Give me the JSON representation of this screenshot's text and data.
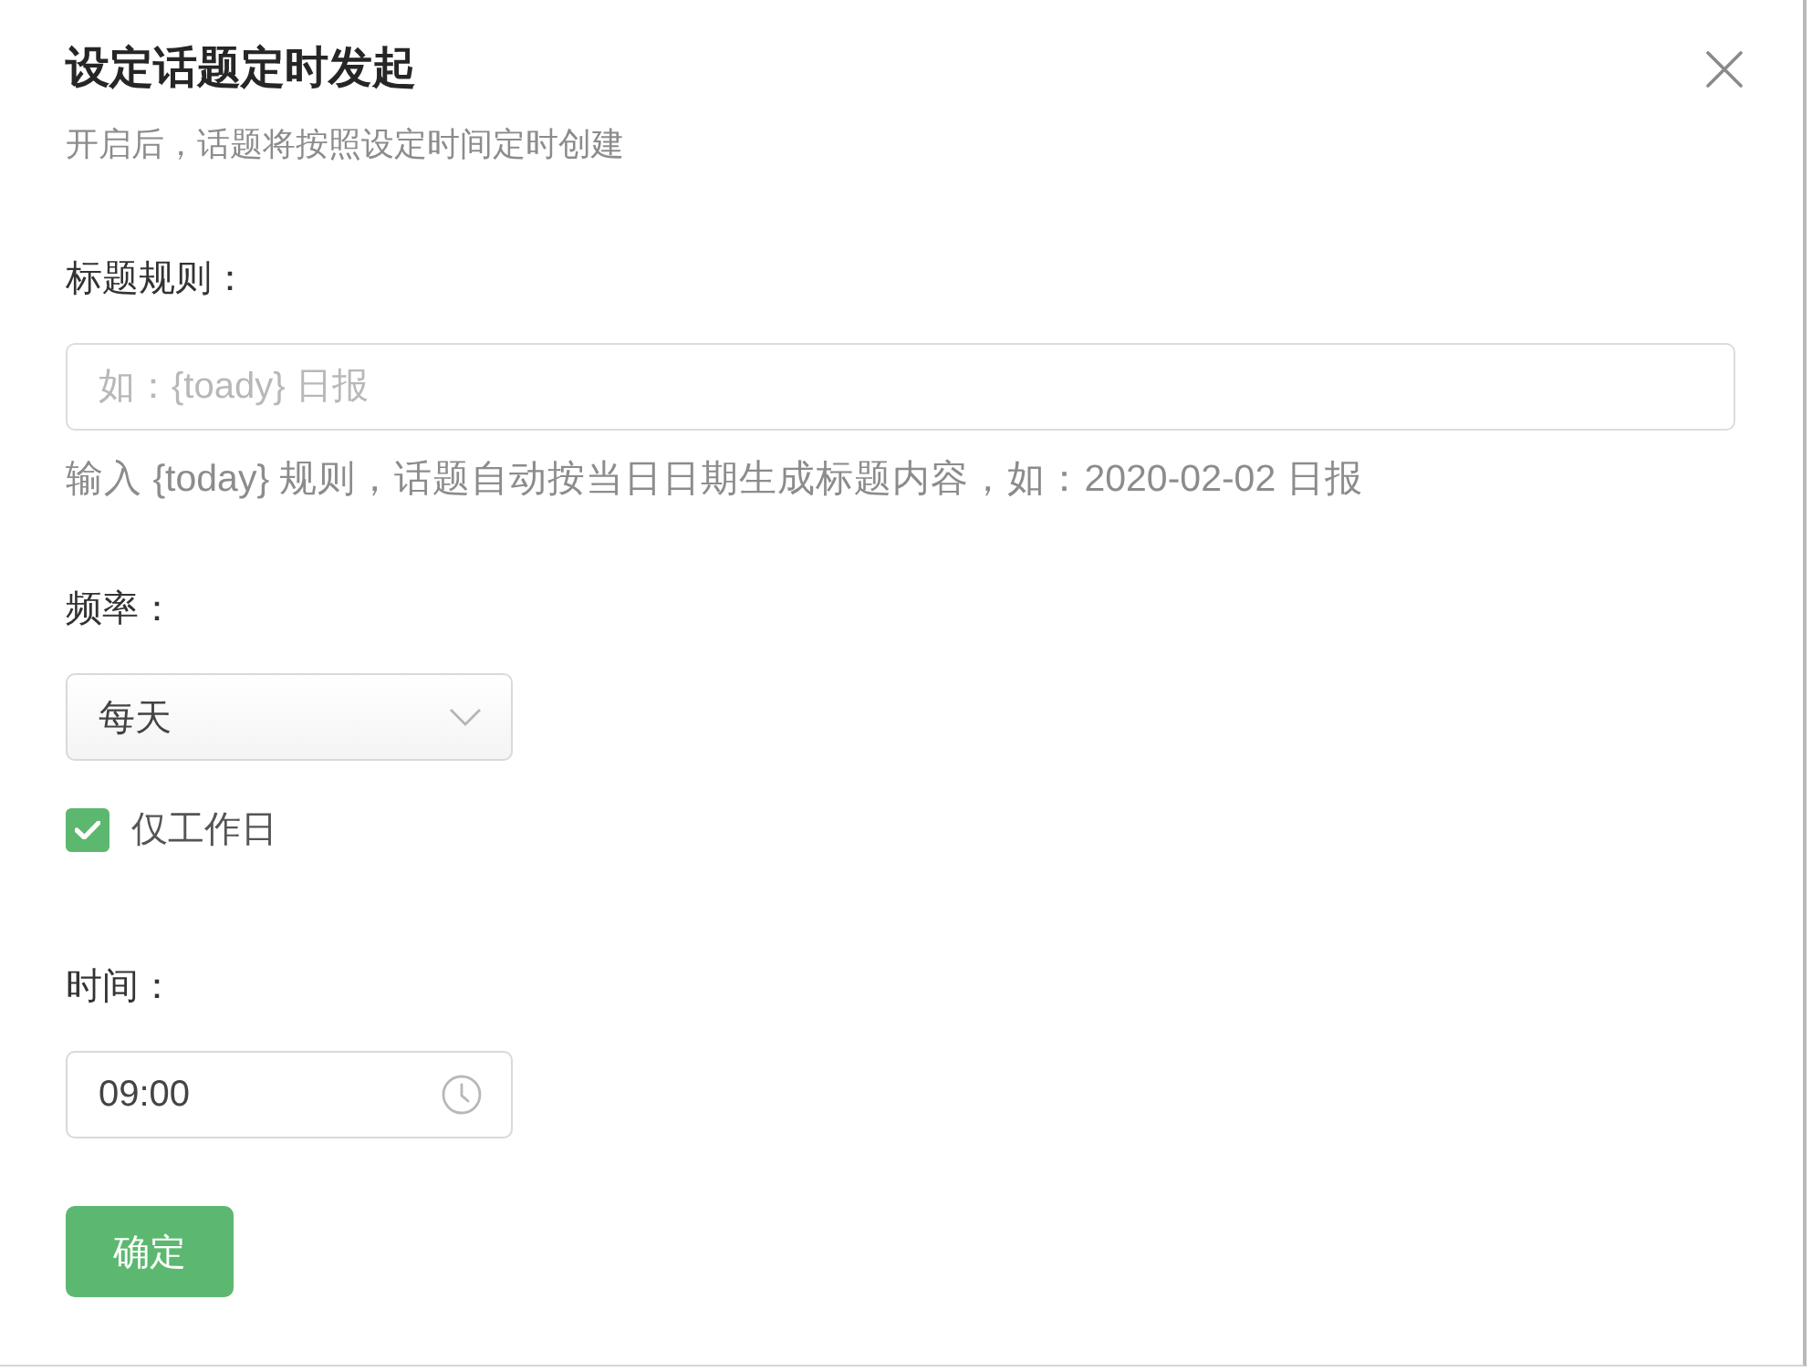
{
  "dialog": {
    "title": "设定话题定时发起",
    "subtitle": "开启后，话题将按照设定时间定时创建"
  },
  "fields": [
    {
      "kind": "text",
      "label": "标题规则：",
      "placeholder": "如：{toady} 日报",
      "hint": "输入 {today} 规则，话题自动按当日日期生成标题内容，如：2020-02-02 日报"
    },
    {
      "kind": "select",
      "label": "频率：",
      "value": "每天"
    },
    {
      "kind": "checkbox",
      "label": "仅工作日",
      "checked": true
    },
    {
      "kind": "time",
      "label": "时间：",
      "value": "09:00"
    }
  ],
  "buttons": [
    {
      "label": "确定"
    }
  ]
}
